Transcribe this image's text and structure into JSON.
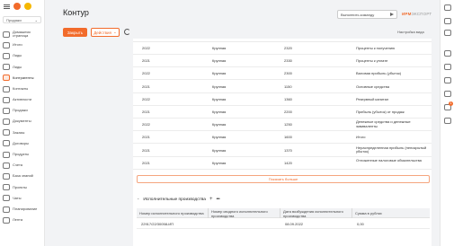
{
  "header": {
    "title": "Контур",
    "run_command_label": "Выполнить команду",
    "logo_main": "ИРМ",
    "logo_sub": "ЭКСПОРТ"
  },
  "sidebar": {
    "select_value": "Продажи",
    "items": [
      {
        "label": "Домашняя страница",
        "icon": "home-icon"
      },
      {
        "label": "Итоги",
        "icon": "chart-icon"
      },
      {
        "label": "Лиды",
        "icon": "lead-icon"
      },
      {
        "label": "Лиды",
        "icon": "funnel-icon"
      },
      {
        "label": "Контрагенты",
        "icon": "contractor-icon",
        "active": true
      },
      {
        "label": "Контакты",
        "icon": "contact-icon"
      },
      {
        "label": "Активности",
        "icon": "activity-icon"
      },
      {
        "label": "Продажи",
        "icon": "sales-icon"
      },
      {
        "label": "Документы",
        "icon": "document-icon"
      },
      {
        "label": "Заказы",
        "icon": "order-icon"
      },
      {
        "label": "Договоры",
        "icon": "contract-icon"
      },
      {
        "label": "Продукты",
        "icon": "product-icon"
      },
      {
        "label": "Счета",
        "icon": "invoice-icon"
      },
      {
        "label": "База знаний",
        "icon": "knowledge-icon"
      },
      {
        "label": "Проекты",
        "icon": "project-icon"
      },
      {
        "label": "Чаты",
        "icon": "chat-icon"
      },
      {
        "label": "Планирование",
        "icon": "planning-icon"
      },
      {
        "label": "Лента",
        "icon": "feed-icon"
      }
    ]
  },
  "toolbar": {
    "close_label": "Закрыть",
    "actions_label": "Действия",
    "view_settings_label": "Настройка вида"
  },
  "rail": {
    "badge": "1",
    "icons": [
      "search-icon",
      "gear-icon",
      "help-icon",
      "phone-icon",
      "email-icon",
      "phone-icon",
      "chat-icon",
      "bell-icon",
      "checklist-icon"
    ]
  },
  "table_rows": [
    {
      "year": "2022",
      "size": "Крупная",
      "code": "2320",
      "name": "Проценты к получению"
    },
    {
      "year": "2021",
      "size": "Крупная",
      "code": "2330",
      "name": "Проценты к уплате"
    },
    {
      "year": "2022",
      "size": "Крупная",
      "code": "2300",
      "name": "Валовая прибыль (убыток)"
    },
    {
      "year": "2021",
      "size": "Крупная",
      "code": "1150",
      "name": "Основные средства"
    },
    {
      "year": "2022",
      "size": "Крупная",
      "code": "1360",
      "name": "Резервный капитал"
    },
    {
      "year": "2021",
      "size": "Крупная",
      "code": "2200",
      "name": "Прибыль (убыток) от продаж"
    },
    {
      "year": "2022",
      "size": "Крупная",
      "code": "1250",
      "name": "Денежные средства и денежные эквиваленты"
    },
    {
      "year": "2021",
      "size": "Крупная",
      "code": "1600",
      "name": "Итого"
    },
    {
      "year": "2021",
      "size": "Крупная",
      "code": "1370",
      "name": "Нераспределенная прибыль (непокрытый убыток)"
    },
    {
      "year": "2021",
      "size": "Крупная",
      "code": "1420",
      "name": "Отложенные налоговые обязательства"
    }
  ],
  "show_more_label": "Показать больше",
  "enforcement": {
    "title": "Исполнительные производства",
    "columns": [
      "Номер исполнительного производства",
      "Номер сводного исполнительного производства",
      "Дата возбуждения исполнительного производства",
      "Сумма в рублях"
    ],
    "rows": [
      {
        "number": "22917/22/30058-ИП",
        "summary_number": "",
        "date": "08.09.2022",
        "amount": "0,00"
      }
    ]
  }
}
